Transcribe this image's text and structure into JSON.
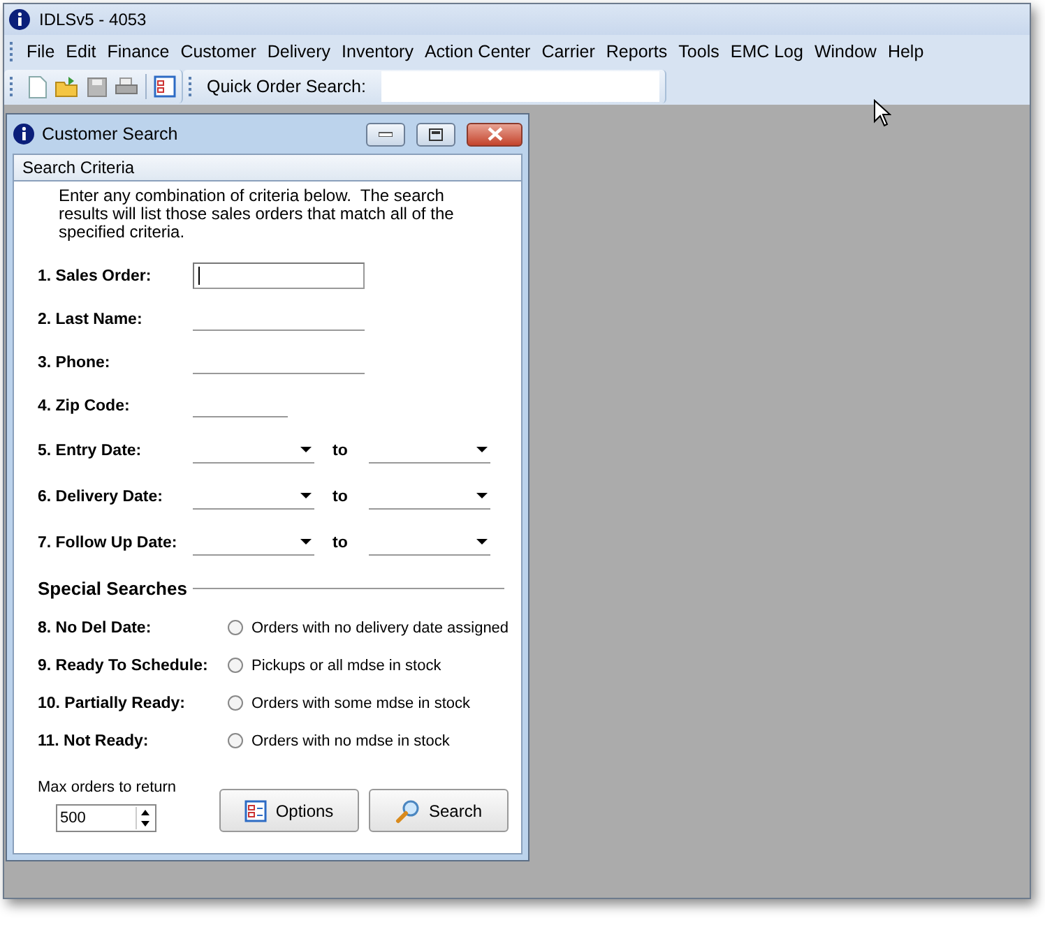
{
  "window": {
    "title": "IDLSv5 - 4053"
  },
  "menu": [
    "File",
    "Edit",
    "Finance",
    "Customer",
    "Delivery",
    "Inventory",
    "Action Center",
    "Carrier",
    "Reports",
    "Tools",
    "EMC Log",
    "Window",
    "Help"
  ],
  "toolbar": {
    "quick_search_label": "Quick Order Search:"
  },
  "dialog": {
    "title": "Customer Search",
    "section": "Search Criteria",
    "instructions": "Enter any combination of criteria below.  The search results will list those sales orders that match all of the specified criteria.",
    "fields": [
      {
        "kind": "text",
        "label": "1. Sales Order:",
        "focused": true
      },
      {
        "kind": "text",
        "label": "2. Last Name:",
        "focused": false
      },
      {
        "kind": "text",
        "label": "3. Phone:",
        "focused": false
      },
      {
        "kind": "short",
        "label": "4. Zip Code:",
        "focused": false
      },
      {
        "kind": "date_range",
        "label": "5. Entry Date:",
        "to": "to"
      },
      {
        "kind": "date_range",
        "label": "6. Delivery Date:",
        "to": "to"
      },
      {
        "kind": "date_range",
        "label": "7. Follow Up Date:",
        "to": "to"
      }
    ],
    "special_title": "Special Searches",
    "special": [
      {
        "label": "8. No Del Date:",
        "option": "Orders with no delivery date assigned",
        "selected": false
      },
      {
        "label": "9. Ready To Schedule:",
        "option": "Pickups or all mdse in stock",
        "selected": false
      },
      {
        "label": "10. Partially Ready:",
        "option": "Orders with some mdse in stock",
        "selected": false
      },
      {
        "label": "11. Not Ready:",
        "option": "Orders with no mdse in stock",
        "selected": false
      }
    ],
    "max_label": "Max orders to return",
    "max_value": "500",
    "buttons": [
      {
        "kind": "options",
        "label": "Options"
      },
      {
        "kind": "search",
        "label": "Search"
      }
    ]
  }
}
